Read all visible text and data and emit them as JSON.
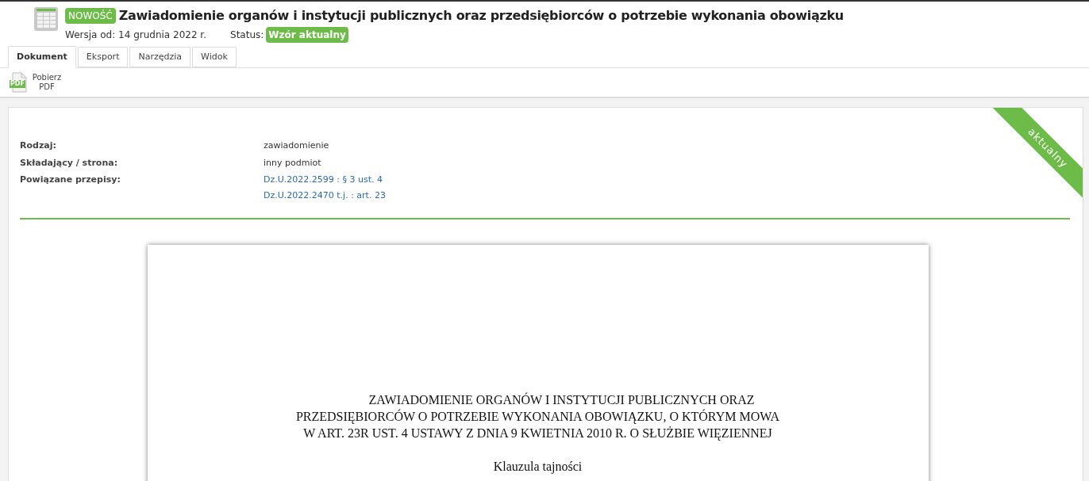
{
  "header": {
    "badge": "NOWOŚĆ",
    "title": "Zawiadomienie organów i instytucji publicznych oraz przedsiębiorców o potrzebie wykonania obowiązku",
    "version": "Wersja od: 14 grudnia 2022 r.",
    "status_label": "Status:",
    "status": "Wzór aktualny"
  },
  "tabs": [
    {
      "label": "Dokument",
      "selected": true
    },
    {
      "label": "Eksport",
      "selected": false
    },
    {
      "label": "Narzędzia",
      "selected": false
    },
    {
      "label": "Widok",
      "selected": false
    }
  ],
  "toolbar": [
    {
      "label": "Pobierz PDF",
      "icon_text": "PDF"
    }
  ],
  "ribbon": "aktualny",
  "details": [
    {
      "label": "Rodzaj:",
      "values": [
        {
          "text": "zawiadomienie",
          "kind": "text"
        }
      ]
    },
    {
      "label": "Składający / strona:",
      "values": [
        {
          "text": "inny podmiot",
          "kind": "text"
        }
      ]
    },
    {
      "label": "Powiązane przepisy:",
      "values": [
        {
          "text": "Dz.U.2022.2599 : § 3 ust. 4",
          "kind": "link"
        },
        {
          "text": "Dz.U.2022.2470 t.j. : art. 23",
          "kind": "link"
        }
      ]
    }
  ],
  "document": {
    "title_lines": [
      "ZAWIADOMIENIE ORGANÓW I INSTYTUCJI PUBLICZNYCH ORAZ",
      "PRZEDSIĘBIORCÓW O POTRZEBIE WYKONANIA OBOWIĄZKU, O KTÓRYM MOWA",
      "W ART. 23R UST. 4 USTAWY Z DNIA 9 KWIETNIA 2010 R. O SŁUŻBIE WIĘZIENNEJ"
    ],
    "subtitle": "Klauzula tajności"
  }
}
